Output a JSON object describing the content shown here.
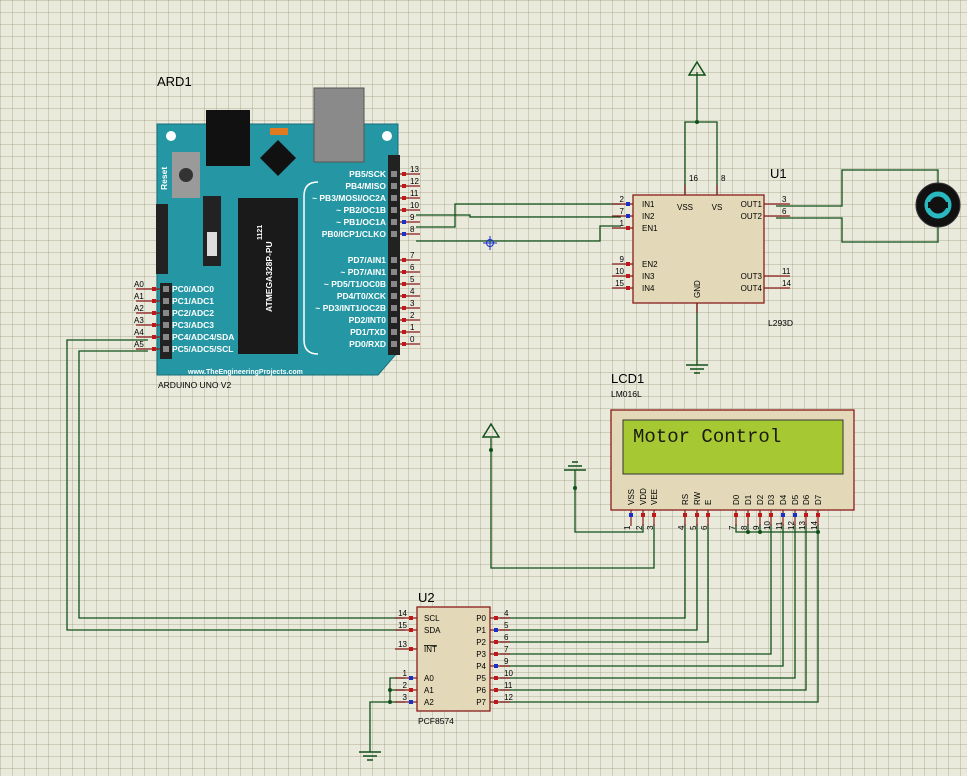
{
  "arduino": {
    "ref": "ARD1",
    "model": "ARDUINO UNO V2",
    "chip_name": "ATMEGA328P-PU",
    "chip_code": "1121",
    "reset_label": "Reset",
    "website": "www.TheEngineeringProjects.com",
    "digital_pins": [
      {
        "label": "PB5/SCK",
        "num": "13"
      },
      {
        "label": "PB4/MISO",
        "num": "12"
      },
      {
        "label": "~ PB3/MOSI/OC2A",
        "num": "11"
      },
      {
        "label": "~ PB2/OC1B",
        "num": "10"
      },
      {
        "label": "~ PB1/OC1A",
        "num": "9"
      },
      {
        "label": "PB0/ICP1/CLKO",
        "num": "8"
      },
      {
        "label": "PD7/AIN1",
        "num": "7"
      },
      {
        "label": "~ PD7/AIN1",
        "num": "6"
      },
      {
        "label": "~ PD5/T1/OC0B",
        "num": "5"
      },
      {
        "label": "PD4/T0/XCK",
        "num": "4"
      },
      {
        "label": "~ PD3/INT1/OC2B",
        "num": "3"
      },
      {
        "label": "PD2/INT0",
        "num": "2"
      },
      {
        "label": "PD1/TXD",
        "num": "1"
      },
      {
        "label": "PD0/RXD",
        "num": "0"
      }
    ],
    "analog_pins": [
      {
        "label": "PC0/ADC0",
        "num": "A0"
      },
      {
        "label": "PC1/ADC1",
        "num": "A1"
      },
      {
        "label": "PC2/ADC2",
        "num": "A2"
      },
      {
        "label": "PC3/ADC3",
        "num": "A3"
      },
      {
        "label": "PC4/ADC4/SDA",
        "num": "A4"
      },
      {
        "label": "PC5/ADC5/SCL",
        "num": "A5"
      }
    ]
  },
  "driver": {
    "ref": "U1",
    "part": "L293D",
    "left_pins": [
      {
        "label": "IN1",
        "num": "2"
      },
      {
        "label": "IN2",
        "num": "7"
      },
      {
        "label": "EN1",
        "num": "1"
      },
      {
        "label": "EN2",
        "num": "9"
      },
      {
        "label": "IN3",
        "num": "10"
      },
      {
        "label": "IN4",
        "num": "15"
      }
    ],
    "right_pins": [
      {
        "label": "OUT1",
        "num": "3"
      },
      {
        "label": "OUT2",
        "num": "6"
      },
      {
        "label": "OUT3",
        "num": "11"
      },
      {
        "label": "OUT4",
        "num": "14"
      }
    ],
    "top_pins": [
      {
        "label": "VSS",
        "num": "16"
      },
      {
        "label": "VS",
        "num": "8"
      }
    ],
    "bottom_pin": {
      "label": "GND"
    }
  },
  "lcd": {
    "ref": "LCD1",
    "part": "LM016L",
    "text": "Motor Control",
    "pins": [
      {
        "label": "VSS",
        "num": "1"
      },
      {
        "label": "VDD",
        "num": "2"
      },
      {
        "label": "VEE",
        "num": "3"
      },
      {
        "label": "RS",
        "num": "4"
      },
      {
        "label": "RW",
        "num": "5"
      },
      {
        "label": "E",
        "num": "6"
      },
      {
        "label": "D0",
        "num": "7"
      },
      {
        "label": "D1",
        "num": "8"
      },
      {
        "label": "D2",
        "num": "9"
      },
      {
        "label": "D3",
        "num": "10"
      },
      {
        "label": "D4",
        "num": "11"
      },
      {
        "label": "D5",
        "num": "12"
      },
      {
        "label": "D6",
        "num": "13"
      },
      {
        "label": "D7",
        "num": "14"
      }
    ]
  },
  "expander": {
    "ref": "U2",
    "part": "PCF8574",
    "left_pins": [
      {
        "label": "SCL",
        "num": "14"
      },
      {
        "label": "SDA",
        "num": "15"
      },
      {
        "label": "INT",
        "num": "13"
      },
      {
        "label": "A0",
        "num": "1"
      },
      {
        "label": "A1",
        "num": "2"
      },
      {
        "label": "A2",
        "num": "3"
      }
    ],
    "right_pins": [
      {
        "label": "P0",
        "num": "4"
      },
      {
        "label": "P1",
        "num": "5"
      },
      {
        "label": "P2",
        "num": "6"
      },
      {
        "label": "P3",
        "num": "7"
      },
      {
        "label": "P4",
        "num": "9"
      },
      {
        "label": "P5",
        "num": "10"
      },
      {
        "label": "P6",
        "num": "11"
      },
      {
        "label": "P7",
        "num": "12"
      }
    ]
  },
  "colors": {
    "board": "#2596a3",
    "wire": "#10501a",
    "chip_body": "#e3d9b8",
    "chip_border": "#8a1c1c",
    "lcd_screen": "#a6c832",
    "pin_red": "#c01818",
    "pin_blue": "#1830c8"
  }
}
